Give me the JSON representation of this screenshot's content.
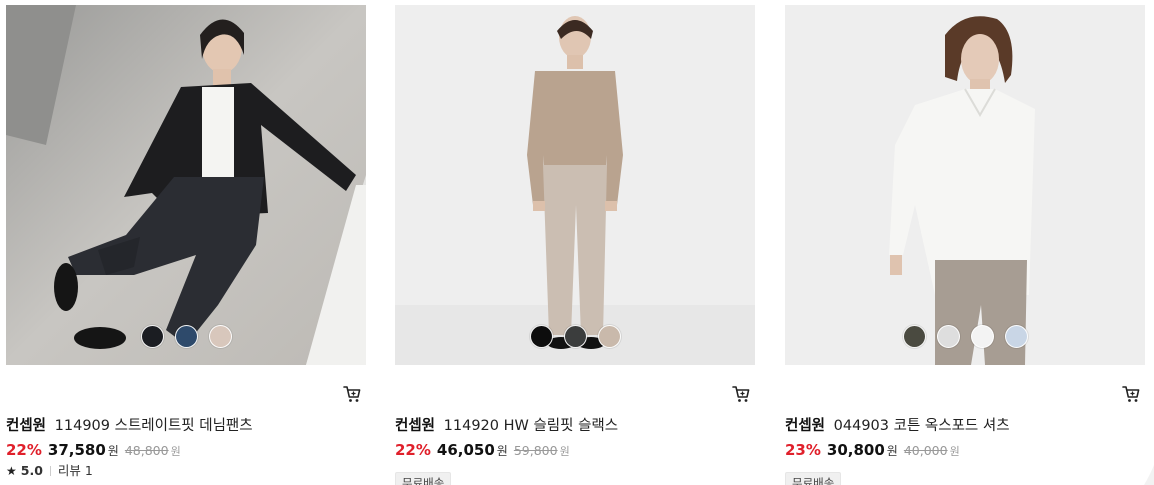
{
  "products": [
    {
      "brand": "컨셉원",
      "name": "114909 스트레이트핏 데님팬츠",
      "discount": "22%",
      "price": "37,580",
      "price_unit": "원",
      "original_price": "48,800",
      "original_unit": "원",
      "rating": "5.0",
      "review_label": "리뷰 1",
      "swatches": [
        "#1b1d22",
        "#2e4a6b",
        "#d8c7bc"
      ]
    },
    {
      "brand": "컨셉원",
      "name": "114920 HW 슬림핏 슬랙스",
      "discount": "22%",
      "price": "46,050",
      "price_unit": "원",
      "original_price": "59,800",
      "original_unit": "원",
      "badge": "무료배송",
      "swatches": [
        "#0d0d0d",
        "#3b3d3d",
        "#c9b9ab"
      ]
    },
    {
      "brand": "컨셉원",
      "name": "044903 코튼 옥스포드 셔츠",
      "discount": "23%",
      "price": "30,800",
      "price_unit": "원",
      "original_price": "40,000",
      "original_unit": "원",
      "badge": "무료배송",
      "swatches": [
        "#4a4a40",
        "#dedede",
        "#f3f3f3",
        "#c9d6e6"
      ]
    }
  ],
  "colors": {
    "discount": "#e0202b",
    "strike": "#999999"
  },
  "icons": {
    "cart": "shopping-cart-icon",
    "star": "star-icon"
  }
}
